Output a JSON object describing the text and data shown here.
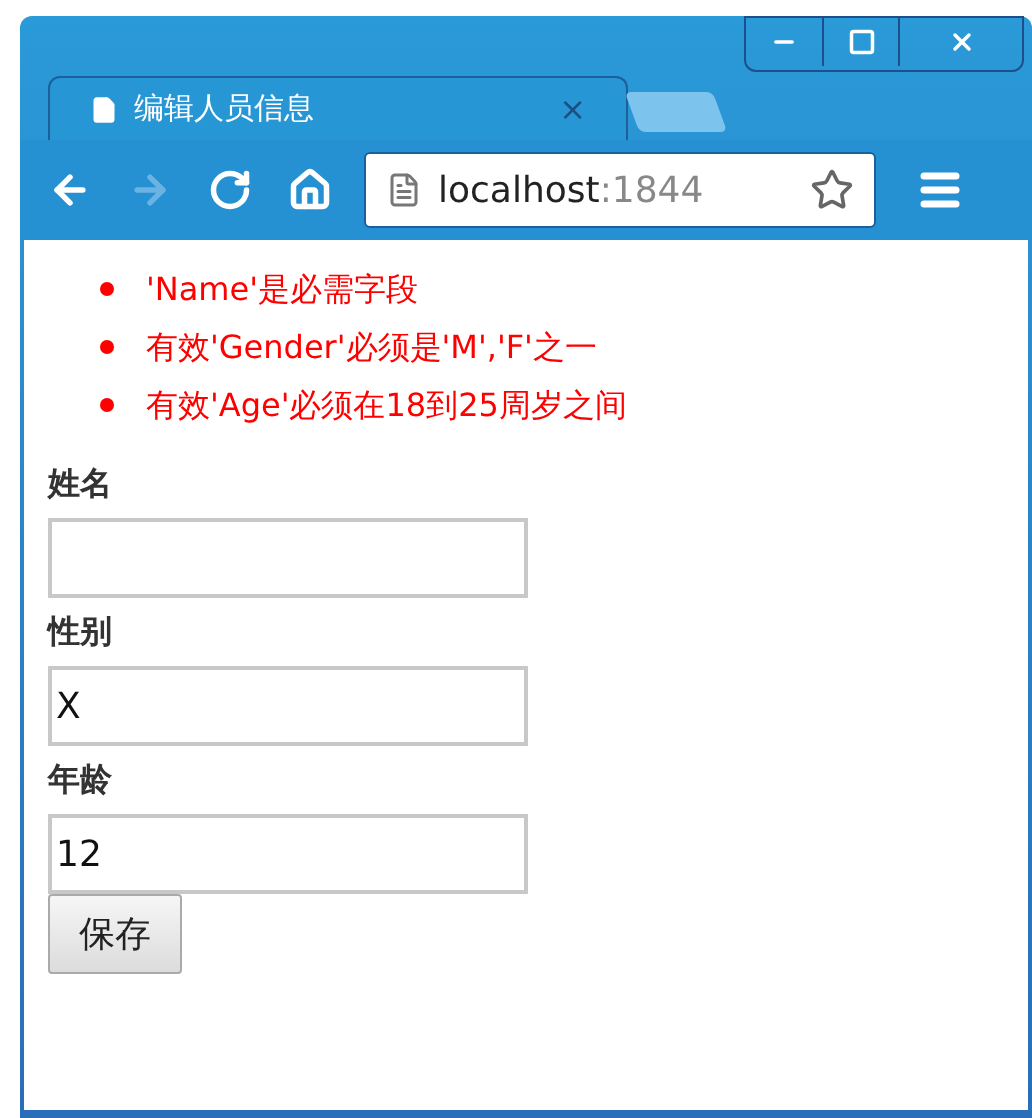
{
  "tab": {
    "title": "编辑人员信息",
    "close": "×"
  },
  "window_controls": [
    {
      "kind": "minimize"
    },
    {
      "kind": "maximize"
    },
    {
      "kind": "close"
    }
  ],
  "nav_buttons": [
    {
      "kind": "back",
      "disabled": false
    },
    {
      "kind": "forward",
      "disabled": true
    },
    {
      "kind": "reload",
      "disabled": false
    },
    {
      "kind": "home",
      "disabled": false
    }
  ],
  "address": {
    "host": "localhost",
    "port": ":1844"
  },
  "errors": [
    "'Name'是必需字段",
    "有效'Gender'必须是'M','F'之一",
    "有效'Age'必须在18到25周岁之间"
  ],
  "fields": [
    {
      "label": "姓名"
    },
    {
      "label": "性别",
      "value": "X"
    },
    {
      "label": "年龄",
      "value": "12"
    }
  ],
  "save_button": "保存"
}
